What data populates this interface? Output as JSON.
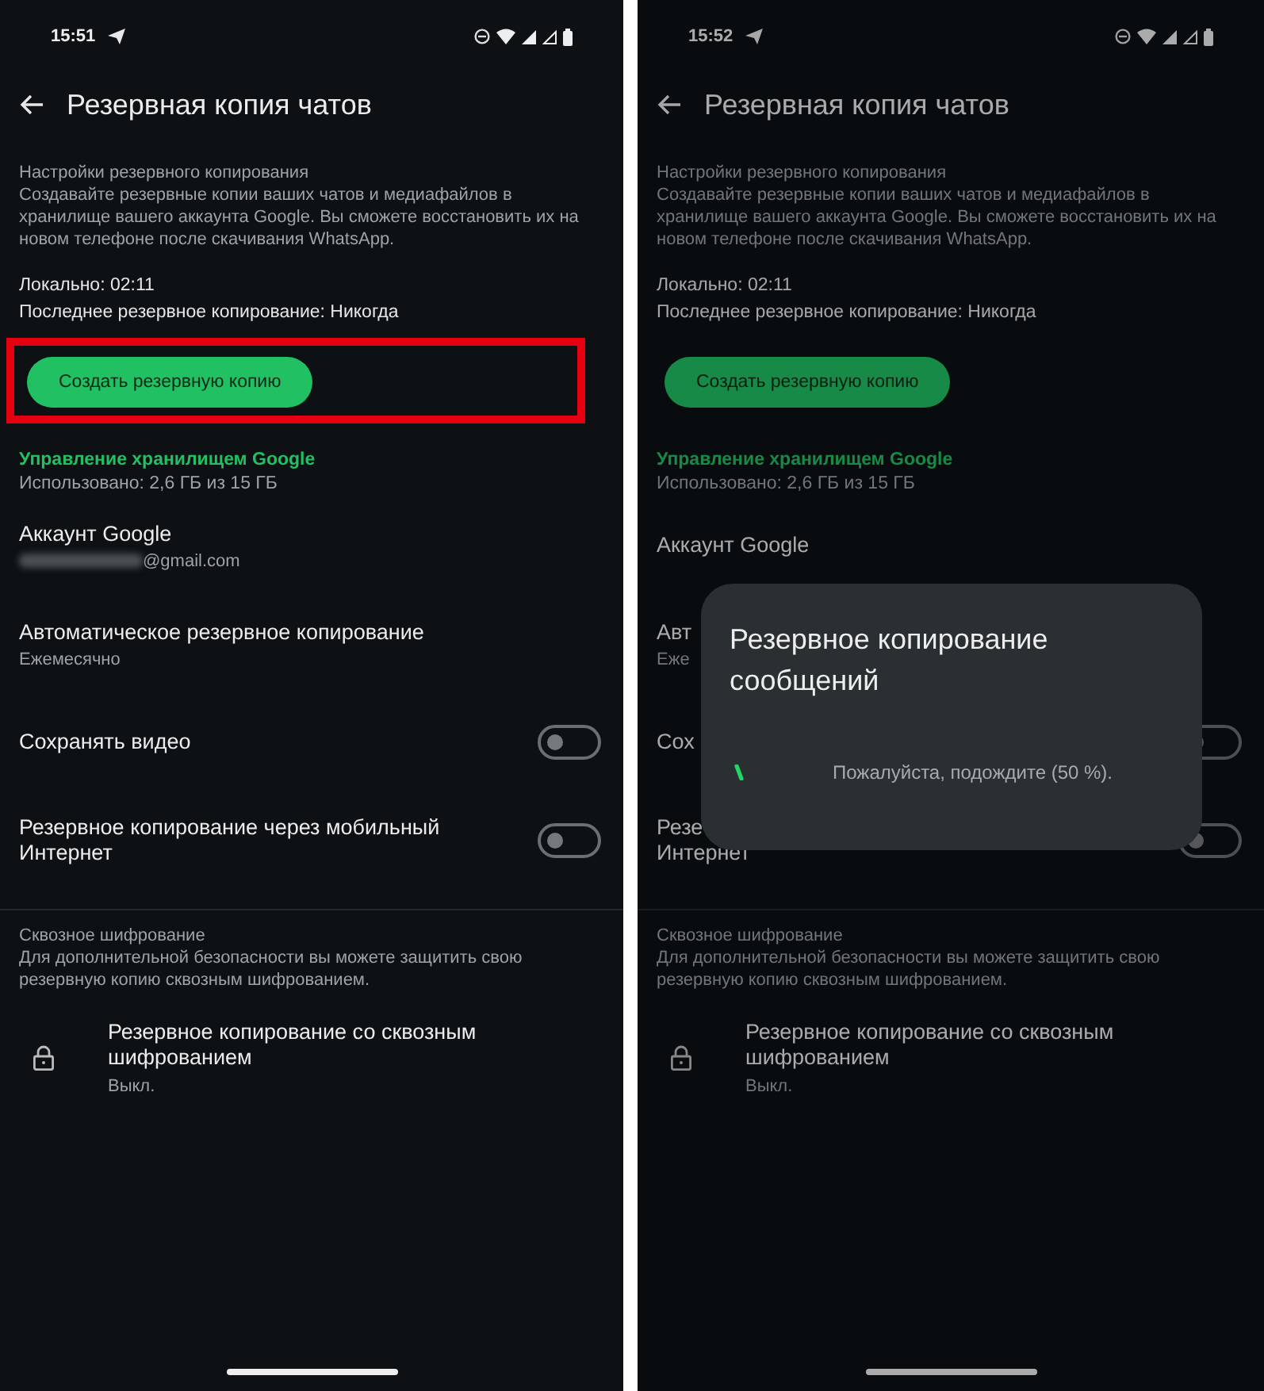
{
  "phones": [
    {
      "status_bar": {
        "time": "15:51"
      },
      "title": "Резервная копия чатов",
      "backup_settings": {
        "heading": "Настройки резервного копирования",
        "description": "Создавайте резервные копии ваших чатов и медиафайлов в хранилище вашего аккаунта Google. Вы сможете восстановить их на новом телефоне после скачивания WhatsApp."
      },
      "local": "Локально: 02:11",
      "last_backup": "Последнее резервное копирование: Никогда",
      "backup_button": {
        "label": "Создать резервную копию",
        "highlighted": true
      },
      "storage": {
        "link": "Управление хранилищем Google",
        "usage": "Использовано: 2,6 ГБ из 15 ГБ"
      },
      "settings": [
        {
          "kind": "value",
          "title_lines": [
            "Аккаунт Google"
          ],
          "value": "@gmail.com",
          "blurred": true
        },
        {
          "kind": "value",
          "title_lines": [
            "Автоматическое резервное копирование"
          ],
          "value": "Ежемесячно"
        },
        {
          "kind": "toggle",
          "title_lines": [
            "Сохранять видео"
          ],
          "on": false
        },
        {
          "kind": "toggle",
          "title_lines": [
            "Резервное копирование через мобильный",
            "Интернет"
          ],
          "on": false
        }
      ],
      "encryption": {
        "heading": "Сквозное шифрование",
        "description": "Для дополнительной безопасности вы можете защитить свою резервную копию сквозным шифрованием.",
        "item_title": "Резервное копирование со сквозным шифрованием",
        "item_value": "Выкл."
      }
    },
    {
      "status_bar": {
        "time": "15:52"
      },
      "title": "Резервная копия чатов",
      "backup_settings": {
        "heading": "Настройки резервного копирования",
        "description": "Создавайте резервные копии ваших чатов и медиафайлов в хранилище вашего аккаунта Google. Вы сможете восстановить их на новом телефоне после скачивания WhatsApp."
      },
      "local": "Локально: 02:11",
      "last_backup": "Последнее резервное копирование: Никогда",
      "backup_button": {
        "label": "Создать резервную копию",
        "highlighted": false
      },
      "storage": {
        "link": "Управление хранилищем Google",
        "usage": "Использовано: 2,6 ГБ из 15 ГБ"
      },
      "settings": [
        {
          "kind": "value",
          "title_lines": [
            "Аккаунт Google"
          ]
        },
        {
          "kind": "value",
          "title_lines": [
            "Авт"
          ],
          "value": "Еже"
        },
        {
          "kind": "toggle",
          "title_lines": [
            "Сох"
          ],
          "on": false
        },
        {
          "kind": "toggle",
          "title_lines": [
            "Резе",
            "Интернет"
          ],
          "on": false
        }
      ],
      "encryption": {
        "heading": "Сквозное шифрование",
        "description": "Для дополнительной безопасности вы можете защитить свою резервную копию сквозным шифрованием.",
        "item_title": "Резервное копирование со сквозным шифрованием",
        "item_value": "Выкл."
      },
      "dialog": {
        "title": "Резервное копирование сообщений",
        "message": "Пожалуйста, подождите (50 %)."
      }
    }
  ]
}
